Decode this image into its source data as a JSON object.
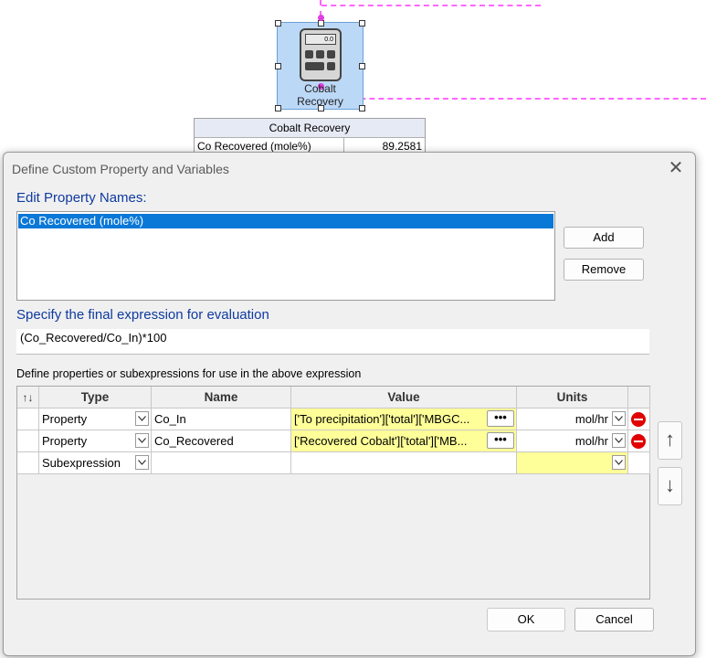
{
  "canvas": {
    "unit_name_line1": "Cobalt",
    "unit_name_line2": "Recovery",
    "calculator_display": "0.0",
    "property_table": {
      "title": "Cobalt Recovery",
      "rows": [
        {
          "name": "Co Recovered (mole%)",
          "value": "89.2581"
        }
      ]
    },
    "connector_color": "#ff66ff"
  },
  "dialog": {
    "title": "Define Custom Property and Variables",
    "edit_names_heading": "Edit Property Names:",
    "property_names": [
      "Co Recovered (mole%)"
    ],
    "add_label": "Add",
    "remove_label": "Remove",
    "expression_heading": "Specify the final expression for evaluation",
    "expression": "(Co_Recovered/Co_In)*100",
    "subexpr_label": "Define properties or subexpressions for use in the above expression",
    "grid": {
      "headers": {
        "sort": "↑↓",
        "type": "Type",
        "name": "Name",
        "value": "Value",
        "units": "Units"
      },
      "rows": [
        {
          "type": "Property",
          "name": "Co_In",
          "value": "['To precipitation']['total']['MBGC...",
          "units": "mol/hr"
        },
        {
          "type": "Property",
          "name": "Co_Recovered",
          "value": "['Recovered Cobalt']['total']['MB...",
          "units": "mol/hr"
        },
        {
          "type": "Subexpression",
          "name": "",
          "value": "",
          "units": ""
        }
      ],
      "ellipsis": "•••"
    },
    "move_up": "↑",
    "move_down": "↓",
    "ok_label": "OK",
    "cancel_label": "Cancel"
  },
  "colors": {
    "selection": "#0a78d7",
    "heading": "#0f3aa0",
    "value_cell": "#ffff99",
    "delete_icon": "#e00000"
  }
}
